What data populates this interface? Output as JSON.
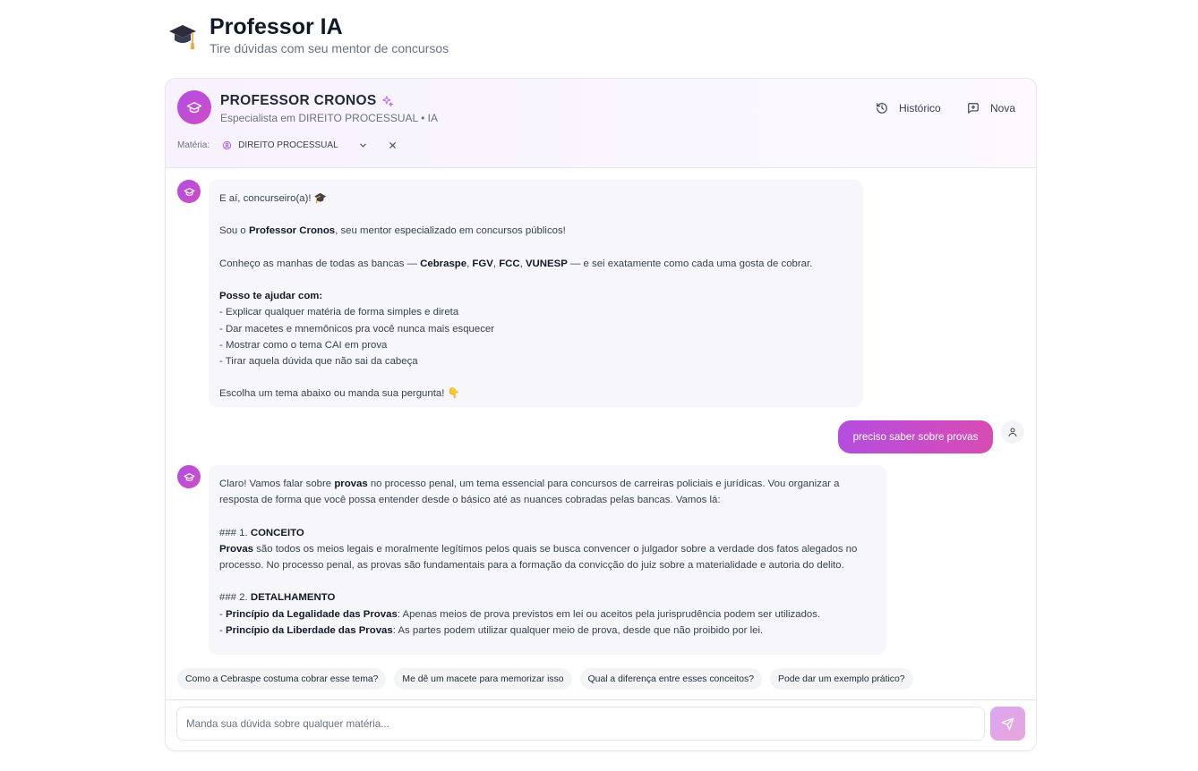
{
  "page": {
    "title": "Professor IA",
    "subtitle": "Tire dúvidas com seu mentor de concursos",
    "title_icon": "graduation-cap-emoji"
  },
  "assistant": {
    "name": "PROFESSOR CRONOS",
    "subtitle": "Especialista em DIREITO PROCESSUAL • IA",
    "avatar_icon": "graduation-cap-icon"
  },
  "header_actions": {
    "history_label": "Histórico",
    "new_label": "Nova"
  },
  "materia": {
    "label": "Matéria:",
    "selected": "DIREITO PROCESSUAL"
  },
  "messages": [
    {
      "role": "assistant",
      "lines": {
        "greeting": "E aí, concurseiro(a)! 🎓",
        "intro_a": "Sou o ",
        "intro_bold": "Professor Cronos",
        "intro_b": ", seu mentor especializado em concursos públicos!",
        "bancas_a": "Conheço as manhas de todas as bancas — ",
        "banca1": "Cebraspe",
        "banca2": "FGV",
        "banca3": "FCC",
        "banca4": "VUNESP",
        "bancas_b": " — e sei exatamente como cada uma gosta de cobrar.",
        "help_title": "Posso te ajudar com:",
        "help1": "- Explicar qualquer matéria de forma simples e direta",
        "help2": "- Dar macetes e mnemônicos pra você nunca mais esquecer",
        "help3": "- Mostrar como o tema CAI em prova",
        "help4": "- Tirar aquela dúvida que não sai da cabeça",
        "closing": "Escolha um tema abaixo ou manda sua pergunta! 👇"
      }
    },
    {
      "role": "user",
      "text": "preciso saber sobre provas"
    },
    {
      "role": "assistant",
      "lines": {
        "p1_a": "Claro! Vamos falar sobre ",
        "p1_bold": "provas",
        "p1_b": " no processo penal, um tema essencial para concursos de carreiras policiais e jurídicas. Vou organizar a resposta de forma que você possa entender desde o básico até as nuances cobradas pelas bancas. Vamos lá:",
        "h1_prefix": "### 1. ",
        "h1_bold": "CONCEITO",
        "c_bold": "Provas",
        "c_text": " são todos os meios legais e moralmente legítimos pelos quais se busca convencer o julgador sobre a verdade dos fatos alegados no processo. No processo penal, as provas são fundamentais para a formação da convicção do juiz sobre a materialidade e autoria do delito.",
        "h2_prefix": "### 2. ",
        "h2_bold": "DETALHAMENTO",
        "d1_bold": "Princípio da Legalidade das Provas",
        "d1_text": ": Apenas meios de prova previstos em lei ou aceitos pela jurisprudência podem ser utilizados.",
        "d2_bold": "Princípio da Liberdade das Provas",
        "d2_text": ": As partes podem utilizar qualquer meio de prova, desde que não proibido por lei."
      }
    }
  ],
  "suggestions": [
    "Como a Cebraspe costuma cobrar esse tema?",
    "Me dê um macete para memorizar isso",
    "Qual a diferença entre esses conceitos?",
    "Pode dar um exemplo prático?"
  ],
  "composer": {
    "placeholder": "Manda sua dúvida sobre qualquer matéria...",
    "value": ""
  },
  "colors": {
    "accent_from": "#b04ee6",
    "accent_to": "#d84cb3",
    "bubble_bg": "#f7f7fb"
  }
}
